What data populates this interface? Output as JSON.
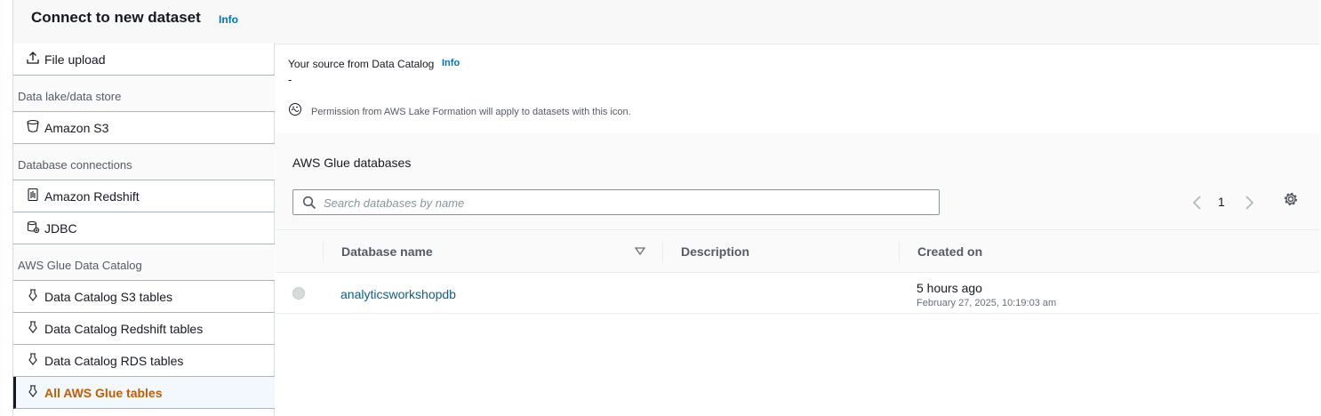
{
  "header": {
    "title": "Connect to new dataset",
    "info": "Info"
  },
  "sidebar": {
    "file_upload": "File upload",
    "group_datalake": "Data lake/data store",
    "amazon_s3": "Amazon S3",
    "group_db": "Database connections",
    "amazon_redshift": "Amazon Redshift",
    "jdbc": "JDBC",
    "group_glue": "AWS Glue Data Catalog",
    "catalog_s3": "Data Catalog S3 tables",
    "catalog_redshift": "Data Catalog Redshift tables",
    "catalog_rds": "Data Catalog RDS tables",
    "all_glue": "All AWS Glue tables"
  },
  "source": {
    "label": "Your source from Data Catalog",
    "info": "Info",
    "value": "-",
    "permission_note": "Permission from AWS Lake Formation will apply to datasets with this icon."
  },
  "databases": {
    "title": "AWS Glue databases",
    "search_placeholder": "Search databases by name",
    "page": "1",
    "columns": {
      "name": "Database name",
      "description": "Description",
      "created": "Created on"
    },
    "rows": [
      {
        "name": "analyticsworkshopdb",
        "description": "",
        "created_relative": "5 hours ago",
        "created_absolute": "February 27, 2025, 10:19:03 am"
      }
    ]
  },
  "colors": {
    "accent": "#0073bb",
    "active": "#c45c00",
    "link": "#0b5f8a"
  }
}
